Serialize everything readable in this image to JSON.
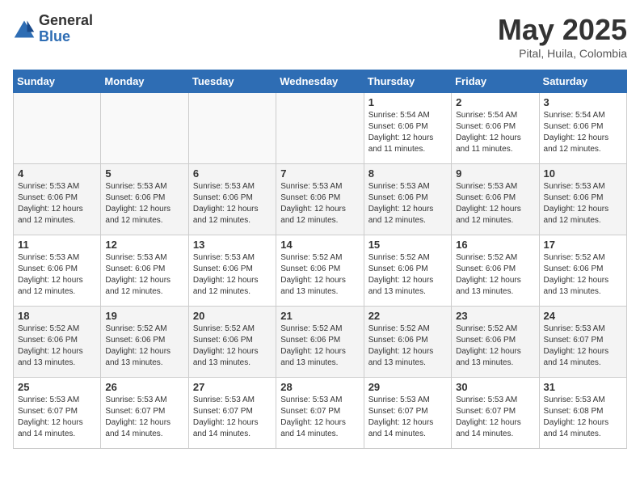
{
  "header": {
    "logo_general": "General",
    "logo_blue": "Blue",
    "month": "May 2025",
    "location": "Pital, Huila, Colombia"
  },
  "weekdays": [
    "Sunday",
    "Monday",
    "Tuesday",
    "Wednesday",
    "Thursday",
    "Friday",
    "Saturday"
  ],
  "weeks": [
    [
      {
        "day": "",
        "info": ""
      },
      {
        "day": "",
        "info": ""
      },
      {
        "day": "",
        "info": ""
      },
      {
        "day": "",
        "info": ""
      },
      {
        "day": "1",
        "info": "Sunrise: 5:54 AM\nSunset: 6:06 PM\nDaylight: 12 hours\nand 11 minutes."
      },
      {
        "day": "2",
        "info": "Sunrise: 5:54 AM\nSunset: 6:06 PM\nDaylight: 12 hours\nand 11 minutes."
      },
      {
        "day": "3",
        "info": "Sunrise: 5:54 AM\nSunset: 6:06 PM\nDaylight: 12 hours\nand 12 minutes."
      }
    ],
    [
      {
        "day": "4",
        "info": "Sunrise: 5:53 AM\nSunset: 6:06 PM\nDaylight: 12 hours\nand 12 minutes."
      },
      {
        "day": "5",
        "info": "Sunrise: 5:53 AM\nSunset: 6:06 PM\nDaylight: 12 hours\nand 12 minutes."
      },
      {
        "day": "6",
        "info": "Sunrise: 5:53 AM\nSunset: 6:06 PM\nDaylight: 12 hours\nand 12 minutes."
      },
      {
        "day": "7",
        "info": "Sunrise: 5:53 AM\nSunset: 6:06 PM\nDaylight: 12 hours\nand 12 minutes."
      },
      {
        "day": "8",
        "info": "Sunrise: 5:53 AM\nSunset: 6:06 PM\nDaylight: 12 hours\nand 12 minutes."
      },
      {
        "day": "9",
        "info": "Sunrise: 5:53 AM\nSunset: 6:06 PM\nDaylight: 12 hours\nand 12 minutes."
      },
      {
        "day": "10",
        "info": "Sunrise: 5:53 AM\nSunset: 6:06 PM\nDaylight: 12 hours\nand 12 minutes."
      }
    ],
    [
      {
        "day": "11",
        "info": "Sunrise: 5:53 AM\nSunset: 6:06 PM\nDaylight: 12 hours\nand 12 minutes."
      },
      {
        "day": "12",
        "info": "Sunrise: 5:53 AM\nSunset: 6:06 PM\nDaylight: 12 hours\nand 12 minutes."
      },
      {
        "day": "13",
        "info": "Sunrise: 5:53 AM\nSunset: 6:06 PM\nDaylight: 12 hours\nand 12 minutes."
      },
      {
        "day": "14",
        "info": "Sunrise: 5:52 AM\nSunset: 6:06 PM\nDaylight: 12 hours\nand 13 minutes."
      },
      {
        "day": "15",
        "info": "Sunrise: 5:52 AM\nSunset: 6:06 PM\nDaylight: 12 hours\nand 13 minutes."
      },
      {
        "day": "16",
        "info": "Sunrise: 5:52 AM\nSunset: 6:06 PM\nDaylight: 12 hours\nand 13 minutes."
      },
      {
        "day": "17",
        "info": "Sunrise: 5:52 AM\nSunset: 6:06 PM\nDaylight: 12 hours\nand 13 minutes."
      }
    ],
    [
      {
        "day": "18",
        "info": "Sunrise: 5:52 AM\nSunset: 6:06 PM\nDaylight: 12 hours\nand 13 minutes."
      },
      {
        "day": "19",
        "info": "Sunrise: 5:52 AM\nSunset: 6:06 PM\nDaylight: 12 hours\nand 13 minutes."
      },
      {
        "day": "20",
        "info": "Sunrise: 5:52 AM\nSunset: 6:06 PM\nDaylight: 12 hours\nand 13 minutes."
      },
      {
        "day": "21",
        "info": "Sunrise: 5:52 AM\nSunset: 6:06 PM\nDaylight: 12 hours\nand 13 minutes."
      },
      {
        "day": "22",
        "info": "Sunrise: 5:52 AM\nSunset: 6:06 PM\nDaylight: 12 hours\nand 13 minutes."
      },
      {
        "day": "23",
        "info": "Sunrise: 5:52 AM\nSunset: 6:06 PM\nDaylight: 12 hours\nand 13 minutes."
      },
      {
        "day": "24",
        "info": "Sunrise: 5:53 AM\nSunset: 6:07 PM\nDaylight: 12 hours\nand 14 minutes."
      }
    ],
    [
      {
        "day": "25",
        "info": "Sunrise: 5:53 AM\nSunset: 6:07 PM\nDaylight: 12 hours\nand 14 minutes."
      },
      {
        "day": "26",
        "info": "Sunrise: 5:53 AM\nSunset: 6:07 PM\nDaylight: 12 hours\nand 14 minutes."
      },
      {
        "day": "27",
        "info": "Sunrise: 5:53 AM\nSunset: 6:07 PM\nDaylight: 12 hours\nand 14 minutes."
      },
      {
        "day": "28",
        "info": "Sunrise: 5:53 AM\nSunset: 6:07 PM\nDaylight: 12 hours\nand 14 minutes."
      },
      {
        "day": "29",
        "info": "Sunrise: 5:53 AM\nSunset: 6:07 PM\nDaylight: 12 hours\nand 14 minutes."
      },
      {
        "day": "30",
        "info": "Sunrise: 5:53 AM\nSunset: 6:07 PM\nDaylight: 12 hours\nand 14 minutes."
      },
      {
        "day": "31",
        "info": "Sunrise: 5:53 AM\nSunset: 6:08 PM\nDaylight: 12 hours\nand 14 minutes."
      }
    ]
  ]
}
